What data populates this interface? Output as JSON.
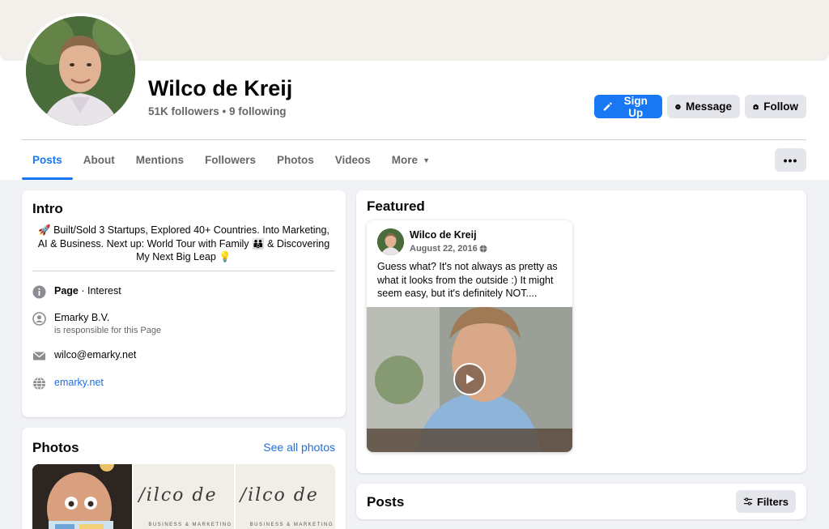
{
  "profile": {
    "name": "Wilco de Kreij",
    "followers_text": "51K followers • 9 following"
  },
  "actions": {
    "sign_up": "Sign Up",
    "message": "Message",
    "follow": "Follow"
  },
  "tabs": [
    {
      "label": "Posts",
      "active": true
    },
    {
      "label": "About"
    },
    {
      "label": "Mentions"
    },
    {
      "label": "Followers"
    },
    {
      "label": "Photos"
    },
    {
      "label": "Videos"
    },
    {
      "label": "More"
    }
  ],
  "more_menu_label": "•••",
  "intro": {
    "title": "Intro",
    "bio": "🚀 Built/Sold 3 Startups, Explored 40+ Countries. Into Marketing, AI & Business. Next up: World Tour with Family 👪 & Discovering My Next Big Leap 💡",
    "page_label": "Page",
    "page_category": " · Interest",
    "responsible_name": "Emarky B.V.",
    "responsible_sub": "is responsible for this Page",
    "email": "wilco@emarky.net",
    "website": "emarky.net"
  },
  "photos": {
    "title": "Photos",
    "see_all": "See all photos",
    "script_text": "/ilco de",
    "caption": "BUSINESS & MARKETING"
  },
  "featured": {
    "title": "Featured",
    "post_author": "Wilco de Kreij",
    "post_date": "August 22, 2016",
    "post_text": "Guess what? It's not always as pretty as what it looks from the outside :) It might seem easy, but it's definitely NOT...."
  },
  "posts": {
    "title": "Posts",
    "filters": "Filters"
  },
  "colors": {
    "accent": "#1877f2",
    "link": "#216fdb",
    "secondary_button": "#e4e6eb",
    "page_background": "#f0f2f5"
  },
  "icons": [
    "pencil-icon",
    "messenger-icon",
    "follow-icon",
    "info-icon",
    "person-badge-icon",
    "mail-icon",
    "globe-icon",
    "play-icon",
    "filters-icon",
    "caret-down-icon"
  ]
}
